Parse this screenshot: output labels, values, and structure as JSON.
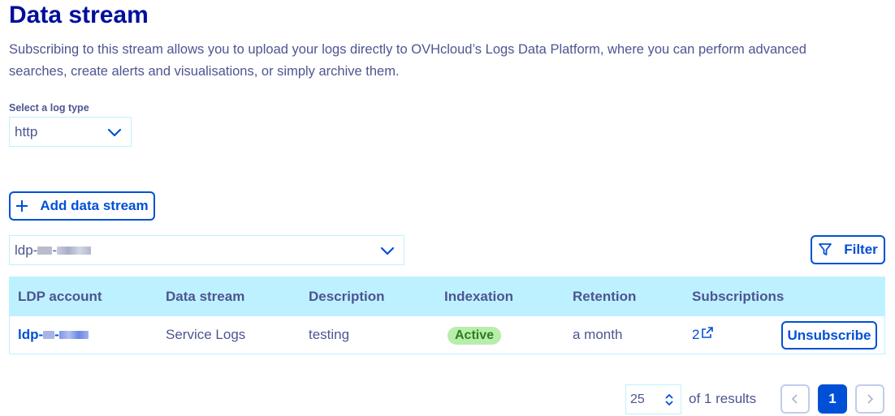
{
  "page": {
    "title": "Data stream",
    "description": "Subscribing to this stream allows you to upload your logs directly to OVHcloud’s Logs Data Platform, where you can perform advanced searches, create alerts and visualisations, or simply archive them."
  },
  "log_type": {
    "label": "Select a log type",
    "selected": "http"
  },
  "actions": {
    "add_label": "Add data stream",
    "filter_label": "Filter"
  },
  "account_select": {
    "prefix": "ldp-"
  },
  "table": {
    "columns": [
      "LDP account",
      "Data stream",
      "Description",
      "Indexation",
      "Retention",
      "Subscriptions"
    ],
    "rows": [
      {
        "account_prefix": "ldp-",
        "data_stream": "Service Logs",
        "description": "testing",
        "indexation": "Active",
        "retention": "a month",
        "subscriptions": "2",
        "action": "Unsubscribe"
      }
    ]
  },
  "pagination": {
    "page_size": "25",
    "results_text": "of 1 results",
    "current_page": "1"
  },
  "colors": {
    "brand": "#000e9c",
    "primary": "#0050d7",
    "text": "#4d5592",
    "header_bg": "#bef1ff",
    "active_badge_bg": "#b7eeab"
  }
}
